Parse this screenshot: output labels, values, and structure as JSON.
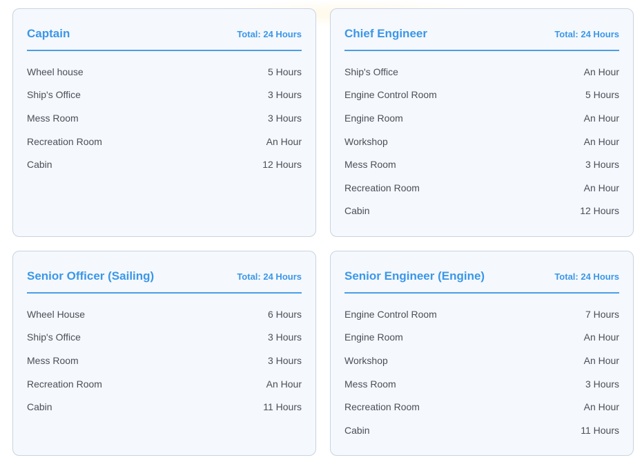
{
  "cards": [
    {
      "title": "Captain",
      "total": "Total: 24 Hours",
      "rows": [
        {
          "location": "Wheel house",
          "hours": "5 Hours"
        },
        {
          "location": "Ship's Office",
          "hours": "3 Hours"
        },
        {
          "location": "Mess Room",
          "hours": "3 Hours"
        },
        {
          "location": "Recreation Room",
          "hours": "An Hour"
        },
        {
          "location": "Cabin",
          "hours": "12 Hours"
        }
      ]
    },
    {
      "title": "Chief Engineer",
      "total": "Total: 24 Hours",
      "rows": [
        {
          "location": "Ship's Office",
          "hours": "An Hour"
        },
        {
          "location": "Engine Control Room",
          "hours": "5 Hours"
        },
        {
          "location": "Engine Room",
          "hours": "An Hour"
        },
        {
          "location": "Workshop",
          "hours": "An Hour"
        },
        {
          "location": "Mess Room",
          "hours": "3 Hours"
        },
        {
          "location": "Recreation Room",
          "hours": "An Hour"
        },
        {
          "location": "Cabin",
          "hours": "12 Hours"
        }
      ]
    },
    {
      "title": "Senior Officer (Sailing)",
      "total": "Total: 24 Hours",
      "rows": [
        {
          "location": "Wheel House",
          "hours": "6 Hours"
        },
        {
          "location": "Ship's Office",
          "hours": "3 Hours"
        },
        {
          "location": "Mess Room",
          "hours": "3 Hours"
        },
        {
          "location": "Recreation Room",
          "hours": "An Hour"
        },
        {
          "location": "Cabin",
          "hours": "11 Hours"
        }
      ]
    },
    {
      "title": "Senior Engineer (Engine)",
      "total": "Total: 24 Hours",
      "rows": [
        {
          "location": "Engine Control Room",
          "hours": "7 Hours"
        },
        {
          "location": "Engine Room",
          "hours": "An Hour"
        },
        {
          "location": "Workshop",
          "hours": "An Hour"
        },
        {
          "location": "Mess Room",
          "hours": "3 Hours"
        },
        {
          "location": "Recreation Room",
          "hours": "An Hour"
        },
        {
          "location": "Cabin",
          "hours": "11 Hours"
        }
      ]
    }
  ],
  "colors": {
    "accent": "#3a97e8",
    "card_background": "#f5f8fd",
    "card_border": "#c8d3df",
    "text": "#4a4f57"
  }
}
